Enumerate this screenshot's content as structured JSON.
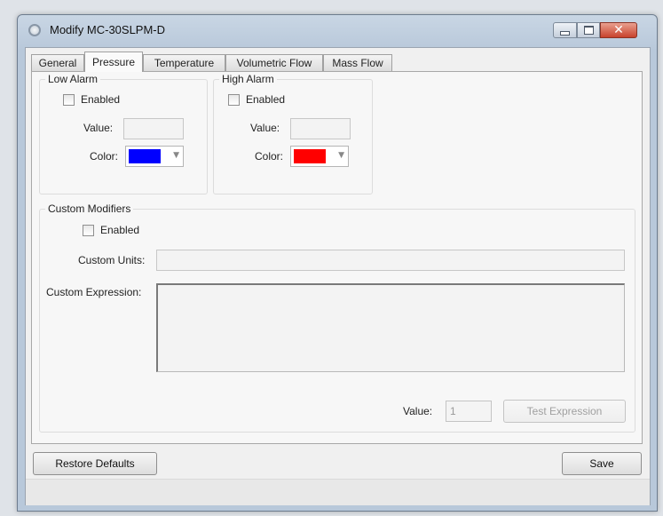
{
  "window": {
    "title": "Modify MC-30SLPM-D",
    "icon": "app-settings-icon",
    "controls": [
      "minimize-icon",
      "maximize-icon",
      "close-icon"
    ]
  },
  "tabs": [
    {
      "label": "General",
      "active": false
    },
    {
      "label": "Pressure",
      "active": true
    },
    {
      "label": "Temperature",
      "active": false
    },
    {
      "label": "Volumetric Flow",
      "active": false
    },
    {
      "label": "Mass Flow",
      "active": false
    }
  ],
  "low_alarm": {
    "title": "Low Alarm",
    "enabled_label": "Enabled",
    "enabled": false,
    "value_label": "Value:",
    "value": "",
    "color_label": "Color:",
    "color": "#0000ff"
  },
  "high_alarm": {
    "title": "High Alarm",
    "enabled_label": "Enabled",
    "enabled": false,
    "value_label": "Value:",
    "value": "",
    "color_label": "Color:",
    "color": "#ff0000"
  },
  "custom_modifiers": {
    "title": "Custom Modifiers",
    "enabled_label": "Enabled",
    "enabled": false,
    "units_label": "Custom Units:",
    "units_value": "",
    "expression_label": "Custom Expression:",
    "expression_value": "",
    "value_label": "Value:",
    "value": "1",
    "test_button": "Test Expression"
  },
  "footer": {
    "restore_button": "Restore Defaults",
    "save_button": "Save"
  }
}
